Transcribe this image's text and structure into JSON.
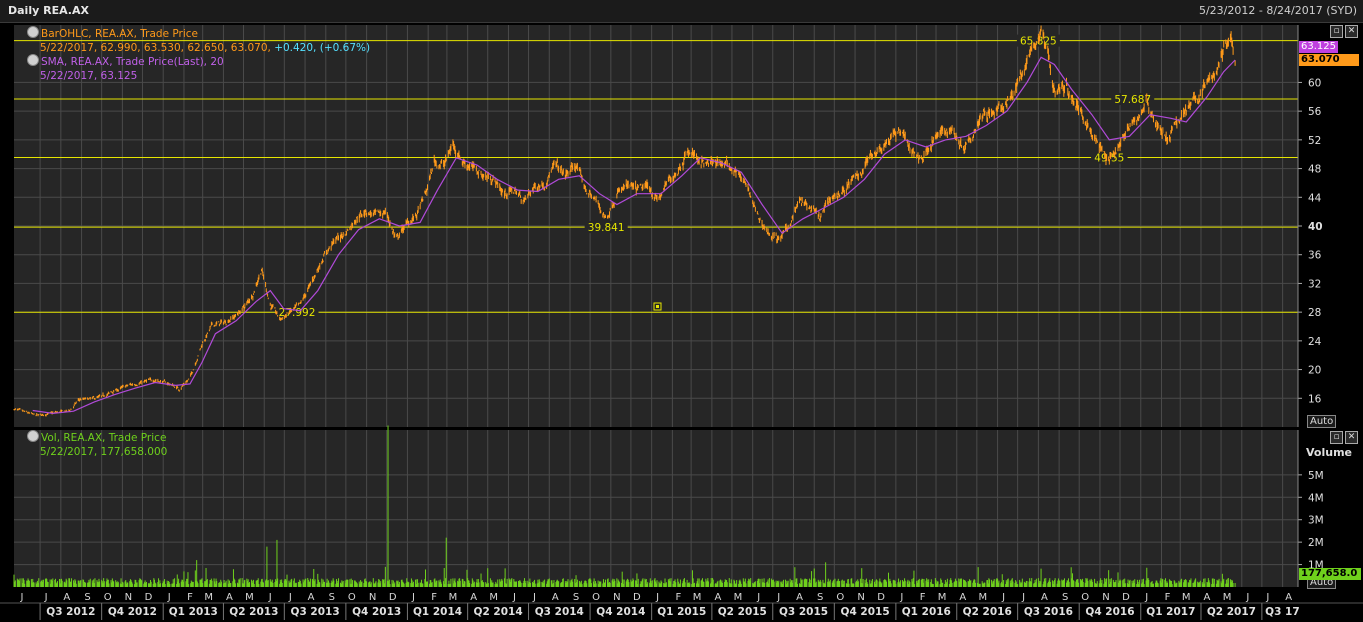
{
  "header": {
    "title": "Daily REA.AX",
    "date_range": "5/23/2012 - 8/24/2017 (SYD)"
  },
  "colors": {
    "background": "#262626",
    "price": "#ff9a1a",
    "sma": "#b04ad8",
    "volume": "#6fd11c",
    "hline": "#e6e600",
    "grid": "#4a4a4a",
    "change": "#55e0ff"
  },
  "legend": {
    "bar_name": "BarOHLC, REA.AX, Trade Price",
    "bar_values": "5/22/2017, 62.990, 63.530, 62.650, 63.070,",
    "bar_change": "+0.420, (+0.67%)",
    "sma_name": "SMA, REA.AX, Trade Price(Last),  20",
    "sma_values": "5/22/2017, 63.125",
    "vol_name": "Vol, REA.AX, Trade Price",
    "vol_values": "5/22/2017, 177,658.000"
  },
  "controls": {
    "restore_icon": "restore-icon",
    "close_icon": "close-icon",
    "auto_label": "Auto",
    "volume_title": "Volume"
  },
  "tags": {
    "sma_last": "63.125",
    "price_last": "63.070",
    "vol_last": "177,658.0"
  },
  "chart_data": [
    {
      "type": "line",
      "title": "Daily REA.AX",
      "ylim": [
        12,
        68
      ],
      "yticks": [
        16,
        20,
        24,
        28,
        32,
        36,
        40,
        44,
        48,
        52,
        56,
        60
      ],
      "ytick_labels": [
        "16",
        "20",
        "24",
        "28",
        "32",
        "36",
        "40",
        "44",
        "48",
        "52",
        "56",
        "60"
      ],
      "y_bold_labels": [
        "40"
      ],
      "x_start": "2012-05-23",
      "x_end": "2017-08-24",
      "months": [
        "J",
        "J",
        "A",
        "S",
        "O",
        "N",
        "D",
        "J",
        "F",
        "M",
        "A",
        "M",
        "J",
        "J",
        "A",
        "S",
        "O",
        "N",
        "D",
        "J",
        "F",
        "M",
        "A",
        "M",
        "J",
        "J",
        "A",
        "S",
        "O",
        "N",
        "D",
        "J",
        "F",
        "M",
        "A",
        "M",
        "J",
        "J",
        "A",
        "S",
        "O",
        "N",
        "D",
        "J",
        "F",
        "M",
        "A",
        "M",
        "J",
        "J",
        "A",
        "S",
        "O",
        "N",
        "D",
        "J",
        "F",
        "M",
        "A",
        "M",
        "J",
        "J",
        "A"
      ],
      "quarters": [
        "Q3 2012",
        "Q4 2012",
        "Q1 2013",
        "Q2 2013",
        "Q3 2013",
        "Q4 2013",
        "Q1 2014",
        "Q2 2014",
        "Q3 2014",
        "Q4 2014",
        "Q1 2015",
        "Q2 2015",
        "Q3 2015",
        "Q4 2015",
        "Q1 2016",
        "Q2 2016",
        "Q3 2016",
        "Q4 2016",
        "Q1 2017",
        "Q2 2017",
        "Q3 17"
      ],
      "horizontal_lines": [
        {
          "value": 65.825,
          "label": "65.825",
          "label_at": "2016-08-01"
        },
        {
          "value": 57.687,
          "label": "57.687",
          "label_at": "2016-12-20"
        },
        {
          "value": 49.55,
          "label": "49.55",
          "label_at": "2016-11-15"
        },
        {
          "value": 39.841,
          "label": "39.841",
          "label_at": "2014-10-25"
        },
        {
          "value": 27.992,
          "label": "27.992",
          "label_at": "2013-07-20"
        }
      ],
      "series": [
        {
          "name": "BarOHLC, REA.AX, Trade Price",
          "style": "ohlc",
          "points": [
            [
              "2012-05-23",
              14.5
            ],
            [
              "2012-06-10",
              14.0
            ],
            [
              "2012-06-25",
              13.6
            ],
            [
              "2012-07-10",
              13.8
            ],
            [
              "2012-07-25",
              14.0
            ],
            [
              "2012-08-15",
              14.3
            ],
            [
              "2012-08-28",
              15.8
            ],
            [
              "2012-09-15",
              15.9
            ],
            [
              "2012-10-01",
              16.2
            ],
            [
              "2012-10-20",
              17.0
            ],
            [
              "2012-11-10",
              17.8
            ],
            [
              "2012-11-30",
              18.2
            ],
            [
              "2012-12-20",
              18.6
            ],
            [
              "2013-01-10",
              18.0
            ],
            [
              "2013-01-25",
              17.3
            ],
            [
              "2013-02-10",
              18.8
            ],
            [
              "2013-02-28",
              23.5
            ],
            [
              "2013-03-15",
              26.2
            ],
            [
              "2013-04-01",
              26.5
            ],
            [
              "2013-04-20",
              27.5
            ],
            [
              "2013-05-05",
              29.0
            ],
            [
              "2013-05-15",
              30.5
            ],
            [
              "2013-05-28",
              34.0
            ],
            [
              "2013-06-10",
              29.0
            ],
            [
              "2013-06-25",
              27.0
            ],
            [
              "2013-07-10",
              28.0
            ],
            [
              "2013-07-25",
              29.0
            ],
            [
              "2013-08-10",
              32.0
            ],
            [
              "2013-08-30",
              36.0
            ],
            [
              "2013-09-15",
              38.0
            ],
            [
              "2013-09-30",
              39.0
            ],
            [
              "2013-10-15",
              41.0
            ],
            [
              "2013-10-30",
              42.0
            ],
            [
              "2013-11-15",
              41.5
            ],
            [
              "2013-11-30",
              42.0
            ],
            [
              "2013-12-15",
              38.0
            ],
            [
              "2013-12-28",
              40.0
            ],
            [
              "2014-01-15",
              41.5
            ],
            [
              "2014-01-30",
              45.0
            ],
            [
              "2014-02-10",
              49.0
            ],
            [
              "2014-02-25",
              48.5
            ],
            [
              "2014-03-10",
              51.5
            ],
            [
              "2014-03-25",
              49.0
            ],
            [
              "2014-04-10",
              48.0
            ],
            [
              "2014-04-25",
              47.0
            ],
            [
              "2014-05-10",
              46.5
            ],
            [
              "2014-05-25",
              44.5
            ],
            [
              "2014-06-10",
              45.0
            ],
            [
              "2014-06-25",
              43.5
            ],
            [
              "2014-07-10",
              45.5
            ],
            [
              "2014-07-25",
              46.0
            ],
            [
              "2014-08-10",
              48.5
            ],
            [
              "2014-08-25",
              47.0
            ],
            [
              "2014-09-10",
              48.5
            ],
            [
              "2014-09-25",
              45.0
            ],
            [
              "2014-10-10",
              43.5
            ],
            [
              "2014-10-25",
              41.0
            ],
            [
              "2014-11-10",
              44.5
            ],
            [
              "2014-11-25",
              45.5
            ],
            [
              "2014-12-10",
              45.0
            ],
            [
              "2014-12-28",
              45.5
            ],
            [
              "2015-01-10",
              43.5
            ],
            [
              "2015-01-25",
              46.0
            ],
            [
              "2015-02-10",
              48.0
            ],
            [
              "2015-02-25",
              50.5
            ],
            [
              "2015-03-10",
              49.5
            ],
            [
              "2015-03-25",
              48.5
            ],
            [
              "2015-04-10",
              49.0
            ],
            [
              "2015-04-25",
              48.5
            ],
            [
              "2015-05-10",
              47.5
            ],
            [
              "2015-05-25",
              45.0
            ],
            [
              "2015-06-10",
              41.0
            ],
            [
              "2015-06-25",
              39.0
            ],
            [
              "2015-07-10",
              38.0
            ],
            [
              "2015-07-25",
              40.0
            ],
            [
              "2015-08-10",
              43.5
            ],
            [
              "2015-08-25",
              42.5
            ],
            [
              "2015-09-10",
              41.0
            ],
            [
              "2015-09-25",
              44.0
            ],
            [
              "2015-10-10",
              44.5
            ],
            [
              "2015-10-25",
              46.0
            ],
            [
              "2015-11-10",
              47.5
            ],
            [
              "2015-11-25",
              50.0
            ],
            [
              "2015-12-10",
              51.0
            ],
            [
              "2015-12-28",
              52.5
            ],
            [
              "2016-01-10",
              53.5
            ],
            [
              "2016-01-25",
              50.0
            ],
            [
              "2016-02-10",
              49.5
            ],
            [
              "2016-02-25",
              52.0
            ],
            [
              "2016-03-10",
              53.0
            ],
            [
              "2016-03-25",
              53.5
            ],
            [
              "2016-04-10",
              51.0
            ],
            [
              "2016-04-25",
              53.0
            ],
            [
              "2016-05-10",
              56.0
            ],
            [
              "2016-05-25",
              55.5
            ],
            [
              "2016-06-10",
              56.5
            ],
            [
              "2016-06-25",
              58.5
            ],
            [
              "2016-07-10",
              62.0
            ],
            [
              "2016-07-25",
              65.0
            ],
            [
              "2016-08-05",
              67.0
            ],
            [
              "2016-08-15",
              64.5
            ],
            [
              "2016-08-25",
              58.5
            ],
            [
              "2016-09-10",
              59.5
            ],
            [
              "2016-09-25",
              57.0
            ],
            [
              "2016-10-10",
              55.0
            ],
            [
              "2016-10-25",
              52.0
            ],
            [
              "2016-11-10",
              49.5
            ],
            [
              "2016-11-25",
              50.5
            ],
            [
              "2016-12-10",
              53.0
            ],
            [
              "2016-12-28",
              55.0
            ],
            [
              "2017-01-10",
              57.5
            ],
            [
              "2017-01-25",
              54.0
            ],
            [
              "2017-02-10",
              52.0
            ],
            [
              "2017-02-25",
              54.5
            ],
            [
              "2017-03-10",
              56.5
            ],
            [
              "2017-03-25",
              57.5
            ],
            [
              "2017-04-10",
              60.0
            ],
            [
              "2017-04-25",
              61.5
            ],
            [
              "2017-05-05",
              64.5
            ],
            [
              "2017-05-15",
              66.5
            ],
            [
              "2017-05-22",
              63.07
            ]
          ]
        },
        {
          "name": "SMA, REA.AX, Trade Price(Last),  20",
          "style": "line",
          "points": [
            [
              "2012-06-20",
              14.3
            ],
            [
              "2012-07-20",
              13.9
            ],
            [
              "2012-08-20",
              14.2
            ],
            [
              "2012-09-20",
              15.5
            ],
            [
              "2012-10-20",
              16.5
            ],
            [
              "2012-11-20",
              17.4
            ],
            [
              "2012-12-20",
              18.2
            ],
            [
              "2013-01-20",
              17.8
            ],
            [
              "2013-02-10",
              18.0
            ],
            [
              "2013-02-28",
              21.0
            ],
            [
              "2013-03-20",
              25.0
            ],
            [
              "2013-04-20",
              26.8
            ],
            [
              "2013-05-20",
              29.5
            ],
            [
              "2013-06-10",
              31.0
            ],
            [
              "2013-06-30",
              28.5
            ],
            [
              "2013-07-25",
              28.2
            ],
            [
              "2013-08-20",
              31.0
            ],
            [
              "2013-09-20",
              36.0
            ],
            [
              "2013-10-20",
              39.5
            ],
            [
              "2013-11-20",
              41.0
            ],
            [
              "2013-12-20",
              40.0
            ],
            [
              "2014-01-20",
              40.5
            ],
            [
              "2014-02-15",
              45.0
            ],
            [
              "2014-03-15",
              49.5
            ],
            [
              "2014-04-15",
              48.5
            ],
            [
              "2014-05-15",
              46.5
            ],
            [
              "2014-06-15",
              45.0
            ],
            [
              "2014-07-15",
              44.8
            ],
            [
              "2014-08-15",
              46.5
            ],
            [
              "2014-09-15",
              47.0
            ],
            [
              "2014-10-15",
              44.5
            ],
            [
              "2014-11-10",
              43.0
            ],
            [
              "2014-12-10",
              44.5
            ],
            [
              "2015-01-15",
              44.5
            ],
            [
              "2015-02-15",
              47.0
            ],
            [
              "2015-03-15",
              49.5
            ],
            [
              "2015-04-15",
              48.8
            ],
            [
              "2015-05-15",
              47.5
            ],
            [
              "2015-06-15",
              43.0
            ],
            [
              "2015-07-15",
              39.0
            ],
            [
              "2015-08-15",
              41.0
            ],
            [
              "2015-09-15",
              42.5
            ],
            [
              "2015-10-15",
              44.0
            ],
            [
              "2015-11-15",
              46.5
            ],
            [
              "2015-12-15",
              50.0
            ],
            [
              "2016-01-15",
              52.0
            ],
            [
              "2016-02-15",
              51.0
            ],
            [
              "2016-03-15",
              52.0
            ],
            [
              "2016-04-15",
              52.5
            ],
            [
              "2016-05-15",
              54.0
            ],
            [
              "2016-06-15",
              56.0
            ],
            [
              "2016-07-15",
              60.0
            ],
            [
              "2016-08-05",
              63.5
            ],
            [
              "2016-08-25",
              62.5
            ],
            [
              "2016-09-20",
              59.0
            ],
            [
              "2016-10-20",
              55.5
            ],
            [
              "2016-11-15",
              52.0
            ],
            [
              "2016-12-15",
              52.5
            ],
            [
              "2017-01-15",
              55.5
            ],
            [
              "2017-02-15",
              55.0
            ],
            [
              "2017-03-10",
              54.5
            ],
            [
              "2017-04-10",
              58.0
            ],
            [
              "2017-05-05",
              61.5
            ],
            [
              "2017-05-22",
              63.125
            ]
          ]
        }
      ]
    },
    {
      "type": "bar",
      "title": "Volume",
      "ylim": [
        0,
        7000000
      ],
      "yticks": [
        1000000,
        2000000,
        3000000,
        4000000,
        5000000
      ],
      "ytick_labels": [
        "1M",
        "2M",
        "3M",
        "4M",
        "5M"
      ],
      "series": [
        {
          "name": "Vol, REA.AX, Trade Price",
          "baseline": 250000,
          "spikes": [
            [
              "2013-02-20",
              1200000
            ],
            [
              "2013-06-05",
              1800000
            ],
            [
              "2013-06-20",
              2100000
            ],
            [
              "2013-12-03",
              7200000
            ],
            [
              "2013-12-15",
              1300000
            ],
            [
              "2014-02-28",
              2200000
            ],
            [
              "2015-09-18",
              1100000
            ],
            [
              "2016-08-06",
              1000000
            ],
            [
              "2017-05-22",
              177658
            ]
          ]
        }
      ]
    }
  ]
}
